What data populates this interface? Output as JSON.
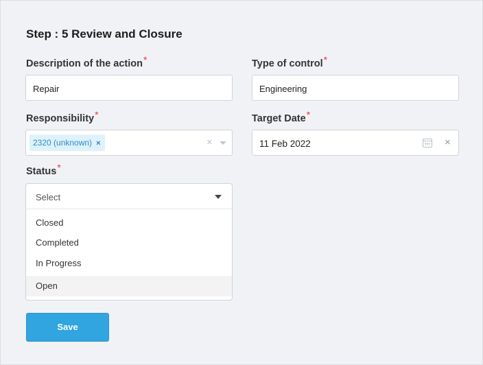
{
  "step_title": "Step : 5 Review and Closure",
  "fields": {
    "description": {
      "label": "Description of the action",
      "required": "*",
      "value": "Repair"
    },
    "type_of_control": {
      "label": "Type of control",
      "required": "*",
      "value": "Engineering"
    },
    "responsibility": {
      "label": "Responsibility",
      "required": "*",
      "tag": "2320 (unknown)",
      "tag_remove": "×",
      "clear": "×"
    },
    "target_date": {
      "label": "Target Date",
      "required": "*",
      "value": "11 Feb 2022",
      "clear": "×"
    },
    "status": {
      "label": "Status",
      "required": "*",
      "placeholder": "Select",
      "options": [
        "Closed",
        "Completed",
        "In Progress",
        "Open"
      ],
      "hovered_option": "Open"
    }
  },
  "save_label": "Save",
  "colors": {
    "accent": "#31a5e0",
    "required": "#e53935",
    "tag_bg": "#dff1fb"
  }
}
